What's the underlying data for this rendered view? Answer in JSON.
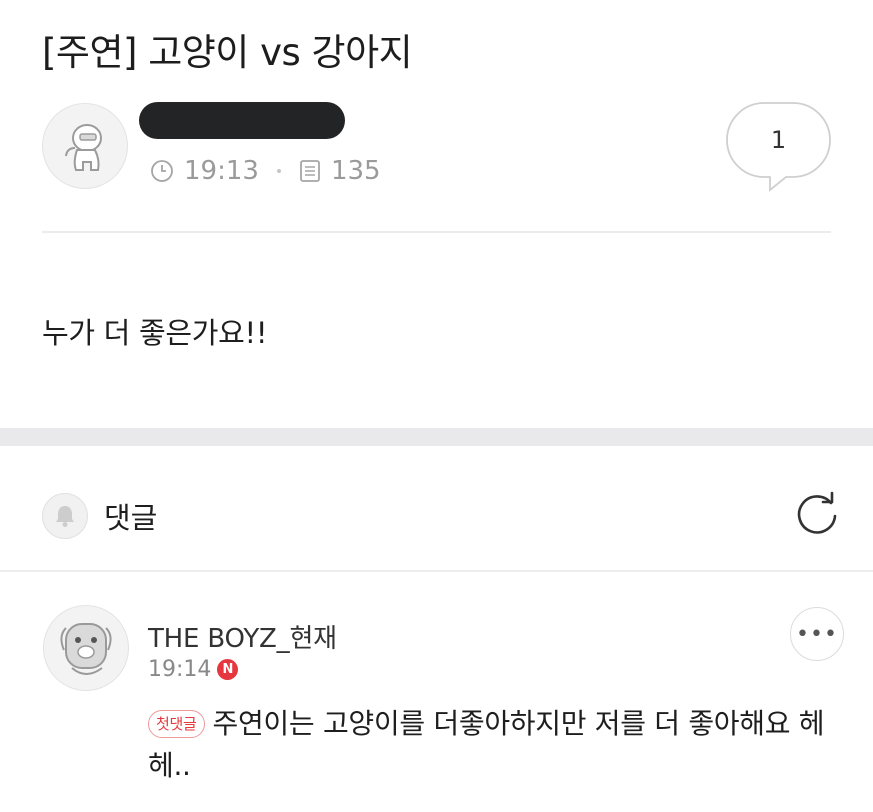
{
  "post": {
    "title": "[주연] 고양이 vs 강아지",
    "time": "19:13",
    "views": "135",
    "comment_count": "1",
    "body": "누가 더 좋은가요!!"
  },
  "comments_section": {
    "label": "댓글",
    "items": [
      {
        "author": "THE BOYZ_현재",
        "time": "19:14",
        "new_badge": "N",
        "first_badge": "첫댓글",
        "text": "주연이는 고양이를 더좋아하지만 저를 더 좋아해요 헤헤.."
      }
    ]
  },
  "icons": {
    "post_avatar": "character-avatar-icon",
    "clock": "clock-icon",
    "views": "document-icon",
    "comment_bubble": "speech-bubble-icon",
    "bell": "bell-icon",
    "refresh": "refresh-icon",
    "more": "more-dots-icon",
    "comment_avatar": "dog-avatar-icon"
  },
  "colors": {
    "accent_red": "#e6373f",
    "band": "#e9e9ec",
    "meta_gray": "#9a9a9a"
  }
}
